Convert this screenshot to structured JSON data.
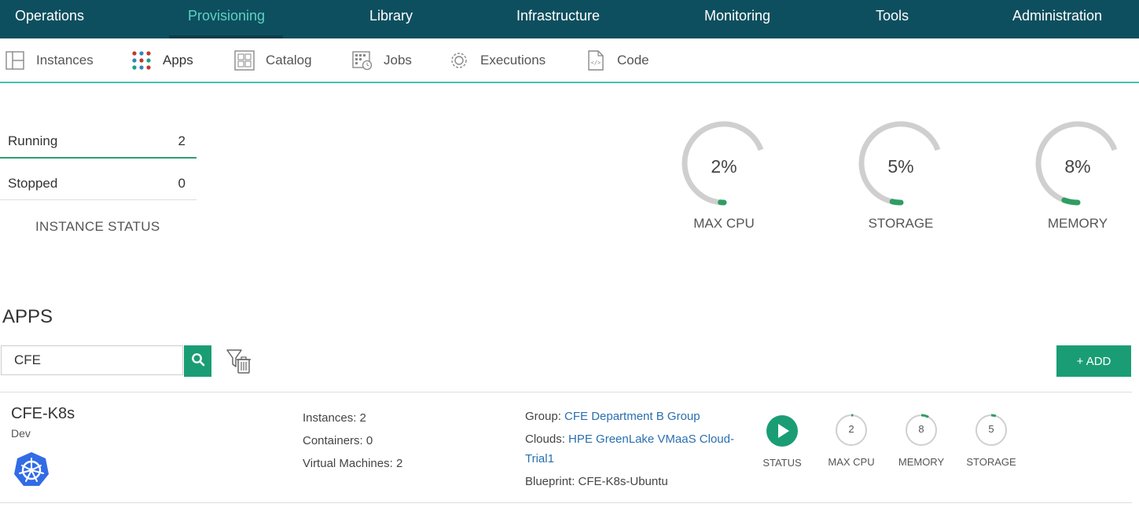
{
  "topnav": {
    "items": [
      {
        "label": "Operations"
      },
      {
        "label": "Provisioning",
        "active": true
      },
      {
        "label": "Library"
      },
      {
        "label": "Infrastructure"
      },
      {
        "label": "Monitoring"
      },
      {
        "label": "Tools"
      },
      {
        "label": "Administration"
      }
    ]
  },
  "subnav": {
    "items": [
      {
        "label": "Instances",
        "icon": "instances-icon"
      },
      {
        "label": "Apps",
        "icon": "apps-icon"
      },
      {
        "label": "Catalog",
        "icon": "catalog-icon"
      },
      {
        "label": "Jobs",
        "icon": "jobs-icon"
      },
      {
        "label": "Executions",
        "icon": "gear-icon"
      },
      {
        "label": "Code",
        "icon": "code-file-icon"
      }
    ]
  },
  "instance_status": {
    "running_label": "Running",
    "running_count": "2",
    "stopped_label": "Stopped",
    "stopped_count": "0",
    "title": "INSTANCE STATUS"
  },
  "gauges": [
    {
      "value": "2%",
      "label": "MAX CPU",
      "fraction": 0.02
    },
    {
      "value": "5%",
      "label": "STORAGE",
      "fraction": 0.05
    },
    {
      "value": "8%",
      "label": "MEMORY",
      "fraction": 0.08
    }
  ],
  "apps": {
    "title": "APPS",
    "search_value": "CFE",
    "add_label": "+ ADD",
    "rows": [
      {
        "name": "CFE-K8s",
        "env": "Dev",
        "logo": "kubernetes-icon",
        "instances": "Instances: 2",
        "containers": "Containers: 0",
        "vms": "Virtual Machines: 2",
        "group_label": "Group: ",
        "group_value": "CFE Department B Group",
        "clouds_label": "Clouds: ",
        "clouds_value": "HPE GreenLake VMaaS Cloud-Trial1",
        "blueprint": "Blueprint: CFE-K8s-Ubuntu",
        "status_label": "STATUS",
        "metrics": [
          {
            "value": "2",
            "label": "MAX CPU",
            "fraction": 0.02
          },
          {
            "value": "8",
            "label": "MEMORY",
            "fraction": 0.08
          },
          {
            "value": "5",
            "label": "STORAGE",
            "fraction": 0.05
          }
        ]
      }
    ]
  },
  "colors": {
    "nav_bg": "#0e4f5f",
    "accent": "#1a9d74",
    "active_nav": "#5ed1c3",
    "link": "#2a6fb0"
  }
}
